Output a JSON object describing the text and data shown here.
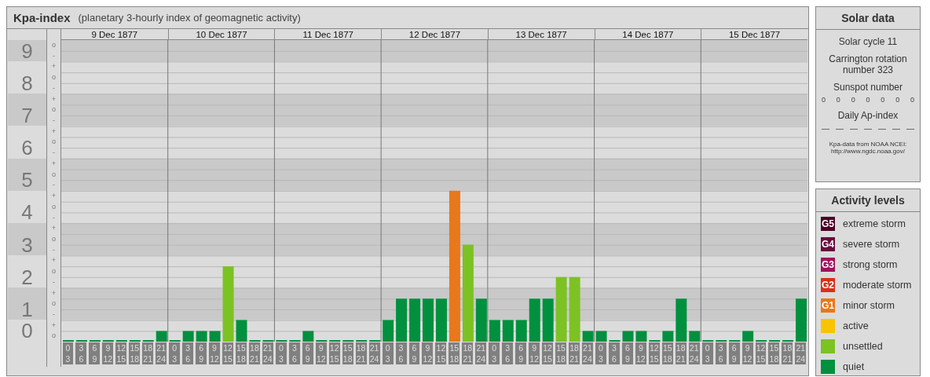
{
  "main_panel": {
    "title": "Kpa-index",
    "subtitle": "(planetary 3-hourly index of geomagnetic activity)"
  },
  "days": [
    {
      "date": "9 Dec 1877",
      "slots": [
        {
          "start": "0",
          "end": "3"
        },
        {
          "start": "3",
          "end": "6"
        },
        {
          "start": "6",
          "end": "9"
        },
        {
          "start": "9",
          "end": "12"
        },
        {
          "start": "12",
          "end": "15"
        },
        {
          "start": "15",
          "end": "18"
        },
        {
          "start": "18",
          "end": "21"
        },
        {
          "start": "21",
          "end": "24"
        }
      ]
    },
    {
      "date": "10 Dec 1877",
      "slots": [
        {
          "start": "0",
          "end": "3"
        },
        {
          "start": "3",
          "end": "6"
        },
        {
          "start": "6",
          "end": "9"
        },
        {
          "start": "9",
          "end": "12"
        },
        {
          "start": "12",
          "end": "15"
        },
        {
          "start": "15",
          "end": "18"
        },
        {
          "start": "18",
          "end": "21"
        },
        {
          "start": "21",
          "end": "24"
        }
      ]
    },
    {
      "date": "11 Dec 1877",
      "slots": [
        {
          "start": "0",
          "end": "3"
        },
        {
          "start": "3",
          "end": "6"
        },
        {
          "start": "6",
          "end": "9"
        },
        {
          "start": "9",
          "end": "12"
        },
        {
          "start": "12",
          "end": "15"
        },
        {
          "start": "15",
          "end": "18"
        },
        {
          "start": "18",
          "end": "21"
        },
        {
          "start": "21",
          "end": "24"
        }
      ]
    },
    {
      "date": "12 Dec 1877",
      "slots": [
        {
          "start": "0",
          "end": "3"
        },
        {
          "start": "3",
          "end": "6"
        },
        {
          "start": "6",
          "end": "9"
        },
        {
          "start": "9",
          "end": "12"
        },
        {
          "start": "12",
          "end": "15"
        },
        {
          "start": "15",
          "end": "18"
        },
        {
          "start": "18",
          "end": "21"
        },
        {
          "start": "21",
          "end": "24"
        }
      ]
    },
    {
      "date": "13 Dec 1877",
      "slots": [
        {
          "start": "0",
          "end": "3"
        },
        {
          "start": "3",
          "end": "6"
        },
        {
          "start": "6",
          "end": "9"
        },
        {
          "start": "9",
          "end": "12"
        },
        {
          "start": "12",
          "end": "15"
        },
        {
          "start": "15",
          "end": "18"
        },
        {
          "start": "18",
          "end": "21"
        },
        {
          "start": "21",
          "end": "24"
        }
      ]
    },
    {
      "date": "14 Dec 1877",
      "slots": [
        {
          "start": "0",
          "end": "3"
        },
        {
          "start": "3",
          "end": "6"
        },
        {
          "start": "6",
          "end": "9"
        },
        {
          "start": "9",
          "end": "12"
        },
        {
          "start": "12",
          "end": "15"
        },
        {
          "start": "15",
          "end": "18"
        },
        {
          "start": "18",
          "end": "21"
        },
        {
          "start": "21",
          "end": "24"
        }
      ]
    },
    {
      "date": "15 Dec 1877",
      "slots": [
        {
          "start": "0",
          "end": "3"
        },
        {
          "start": "3",
          "end": "6"
        },
        {
          "start": "6",
          "end": "9"
        },
        {
          "start": "9",
          "end": "12"
        },
        {
          "start": "12",
          "end": "15"
        },
        {
          "start": "15",
          "end": "18"
        },
        {
          "start": "18",
          "end": "21"
        },
        {
          "start": "21",
          "end": "24"
        }
      ]
    }
  ],
  "sub_ticks": [
    "o",
    "-",
    "+",
    "o",
    "-",
    "+",
    "o",
    "-",
    "+",
    "o",
    "-",
    "+",
    "o",
    "-",
    "+",
    "o",
    "-",
    "+",
    "o",
    "-",
    "+",
    "o",
    "-",
    "+",
    "o",
    "-",
    "+",
    "o"
  ],
  "baseline_label": "0",
  "chart_data": {
    "type": "bar",
    "ylim": [
      0,
      9.33
    ],
    "yticks": [
      1,
      2,
      3,
      4,
      5,
      6,
      7,
      8,
      9
    ],
    "grid": true,
    "bands": [
      {
        "axis": "y",
        "from": 8.67,
        "to": 9.33
      },
      {
        "axis": "y",
        "from": 6.67,
        "to": 7.67
      },
      {
        "axis": "y",
        "from": 4.67,
        "to": 5.67
      },
      {
        "axis": "y",
        "from": 2.67,
        "to": 3.67
      },
      {
        "axis": "y",
        "from": 0.67,
        "to": 1.67
      }
    ],
    "series": [
      {
        "values": [
          0,
          0,
          0,
          0,
          0,
          0,
          0,
          0.33,
          0,
          0.33,
          0.33,
          0.33,
          2.33,
          0.67,
          0,
          0,
          0,
          0,
          0.33,
          0,
          0,
          0,
          0,
          0,
          0.67,
          1.33,
          1.33,
          1.33,
          1.33,
          4.67,
          3,
          1.33,
          0.67,
          0.67,
          0.67,
          1.33,
          1.33,
          2,
          2,
          0.33,
          0.33,
          0,
          0.33,
          0.33,
          0,
          0.33,
          1.33,
          0.33,
          0,
          0,
          0,
          0.33,
          0,
          0,
          0,
          1.33
        ]
      }
    ]
  },
  "solar_data": {
    "title": "Solar data",
    "solar_cycle": "Solar cycle 11",
    "carrington": "Carrington rotation number 323",
    "sunspot_label": "Sunspot number",
    "sunspots": [
      "0",
      "0",
      "0",
      "0",
      "0",
      "0",
      "0"
    ],
    "ap_label": "Daily Ap-index",
    "ap_values": [
      "—",
      "—",
      "—",
      "—",
      "—",
      "—",
      "—"
    ],
    "source": "Kpa-data from NOAA NCEI:",
    "source_url": "http://www.ngdc.noaa.gov/"
  },
  "activity_levels": {
    "title": "Activity levels",
    "items": [
      {
        "badge": "G5",
        "label": "extreme storm",
        "color": "#4a0026"
      },
      {
        "badge": "G4",
        "label": "severe storm",
        "color": "#6a0a3c"
      },
      {
        "badge": "G3",
        "label": "strong storm",
        "color": "#a3105e"
      },
      {
        "badge": "G2",
        "label": "moderate storm",
        "color": "#d8301c"
      },
      {
        "badge": "G1",
        "label": "minor storm",
        "color": "#e8781a"
      },
      {
        "label": "active",
        "color": "#f8c400"
      },
      {
        "label": "unsettled",
        "color": "#7cc223"
      },
      {
        "label": "quiet",
        "color": "#00903e"
      }
    ]
  }
}
